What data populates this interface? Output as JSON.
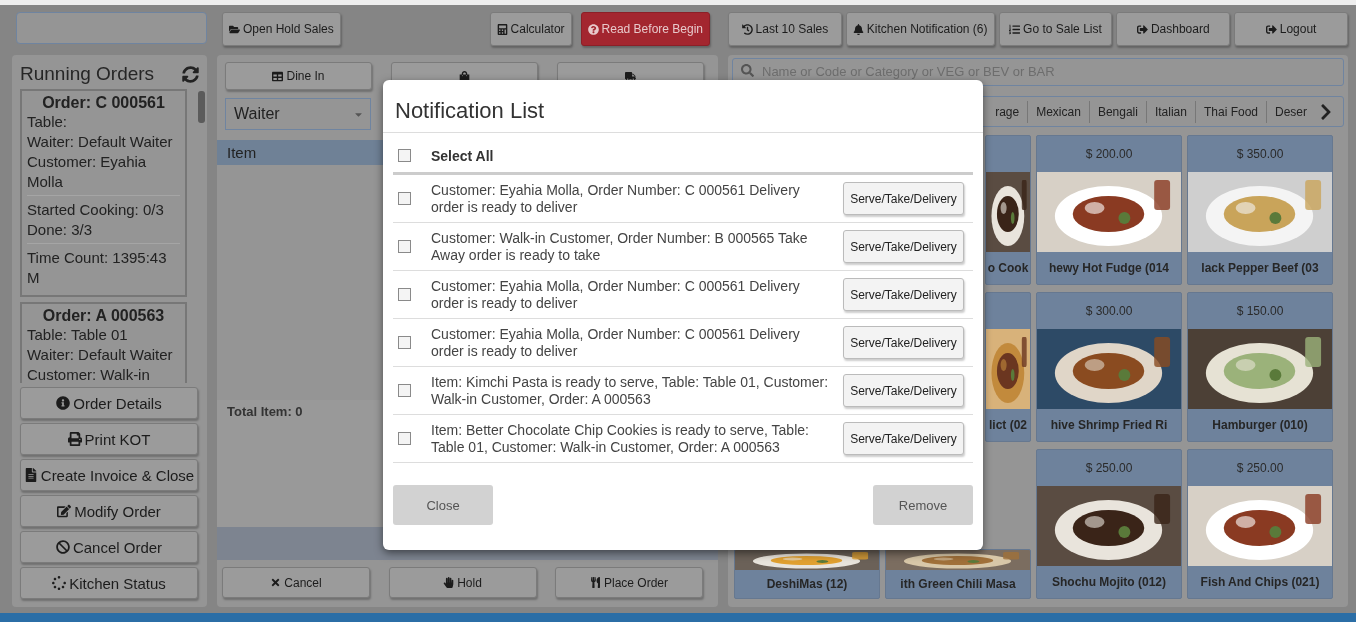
{
  "top_bar": {
    "left_buttons": [
      {
        "label": "Open Hold Sales"
      }
    ],
    "middle_buttons": [
      {
        "label": "Calculator",
        "kind": "plain"
      },
      {
        "label": "Read Before Begin",
        "kind": "danger"
      }
    ],
    "right_buttons": [
      {
        "label": "Last 10 Sales"
      },
      {
        "label": "Kitchen Notification (6)"
      },
      {
        "label": "Go to Sale List"
      },
      {
        "label": "Dashboard"
      },
      {
        "label": "Logout"
      }
    ]
  },
  "running_orders": {
    "title": "Running Orders",
    "orders": [
      {
        "title": "Order: C 000561",
        "groups": [
          [
            "Table:",
            "Waiter: Default Waiter",
            "Customer: Eyahia Molla"
          ],
          [
            "Started Cooking: 0/3",
            "Done: 3/3"
          ],
          [
            "Time Count: 1395:43 M"
          ]
        ]
      },
      {
        "title": "Order: A 000563",
        "groups": [
          [
            "Table: Table 01",
            "Waiter: Default Waiter",
            "Customer: Walk-in"
          ]
        ]
      }
    ],
    "actions": [
      {
        "label": "Order Details"
      },
      {
        "label": "Print KOT"
      },
      {
        "label": "Create Invoice & Close"
      },
      {
        "label": "Modify Order"
      },
      {
        "label": "Cancel Order"
      },
      {
        "label": "Kitchen Status"
      }
    ]
  },
  "order_panel": {
    "order_types": [
      {
        "kind": "dine-in",
        "label": "Dine In"
      },
      {
        "kind": "take-away"
      },
      {
        "kind": "delivery"
      }
    ],
    "waiter_select": {
      "value": "Waiter"
    },
    "table_header": "Item",
    "total": "Total Item: 0",
    "buttons": [
      {
        "label": "Cancel"
      },
      {
        "label": "Hold"
      },
      {
        "label": "Place Order"
      }
    ]
  },
  "menu_panel": {
    "search": {
      "placeholder": "Name or Code or Category or VEG or BEV or BAR"
    },
    "categories": [
      {
        "label": "rage"
      },
      {
        "label": "Mexican"
      },
      {
        "label": "Bengali"
      },
      {
        "label": "Italian"
      },
      {
        "label": "Thai Food"
      },
      {
        "label": "Deser"
      }
    ],
    "items": [
      {
        "kind": "covered"
      },
      {
        "kind": "edge",
        "name": "o Cook"
      },
      {
        "kind": "card",
        "price": "$ 200.00",
        "name": "hewy Hot Fudge (014"
      },
      {
        "kind": "card",
        "price": "$ 350.00",
        "name": "lack Pepper Beef (03"
      },
      {
        "kind": "covered"
      },
      {
        "kind": "edge",
        "name": "lict (02"
      },
      {
        "kind": "card",
        "price": "$ 300.00",
        "name": "hive Shrimp Fried Ri"
      },
      {
        "kind": "card",
        "price": "$ 150.00",
        "name": "Hamburger (010)"
      },
      {
        "kind": "lower",
        "name": "DeshiMas (12)"
      },
      {
        "kind": "lower",
        "name": "ith Green Chili Masa"
      },
      {
        "kind": "card",
        "price": "$ 250.00",
        "name": "Shochu Mojito (012)"
      },
      {
        "kind": "card",
        "price": "$ 250.00",
        "name": "Fish And Chips (021)"
      }
    ]
  },
  "modal": {
    "title": "Notification List",
    "select_all": {
      "label": "Select All",
      "checked": false
    },
    "notifications": [
      {
        "text": "Customer: Eyahia Molla, Order Number: C 000561 Delivery order is ready to deliver",
        "checked": false,
        "action": "Serve/Take/Delivery"
      },
      {
        "text": "Customer: Walk-in Customer, Order Number: B 000565 Take Away order is ready to take",
        "checked": false,
        "action": "Serve/Take/Delivery"
      },
      {
        "text": "Customer: Eyahia Molla, Order Number: C 000561 Delivery order is ready to deliver",
        "checked": false,
        "action": "Serve/Take/Delivery"
      },
      {
        "text": "Customer: Eyahia Molla, Order Number: C 000561 Delivery order is ready to deliver",
        "checked": false,
        "action": "Serve/Take/Delivery"
      },
      {
        "text": "Item: Kimchi Pasta is ready to serve, Table: Table 01, Customer: Walk-in Customer, Order: A 000563",
        "checked": false,
        "action": "Serve/Take/Delivery"
      },
      {
        "text": "Item: Better Chocolate Chip Cookies is ready to serve, Table: Table 01, Customer: Walk-in Customer, Order: A 000563",
        "checked": false,
        "action": "Serve/Take/Delivery"
      }
    ],
    "buttons": [
      {
        "label": "Close"
      },
      {
        "label": "Remove"
      }
    ]
  }
}
